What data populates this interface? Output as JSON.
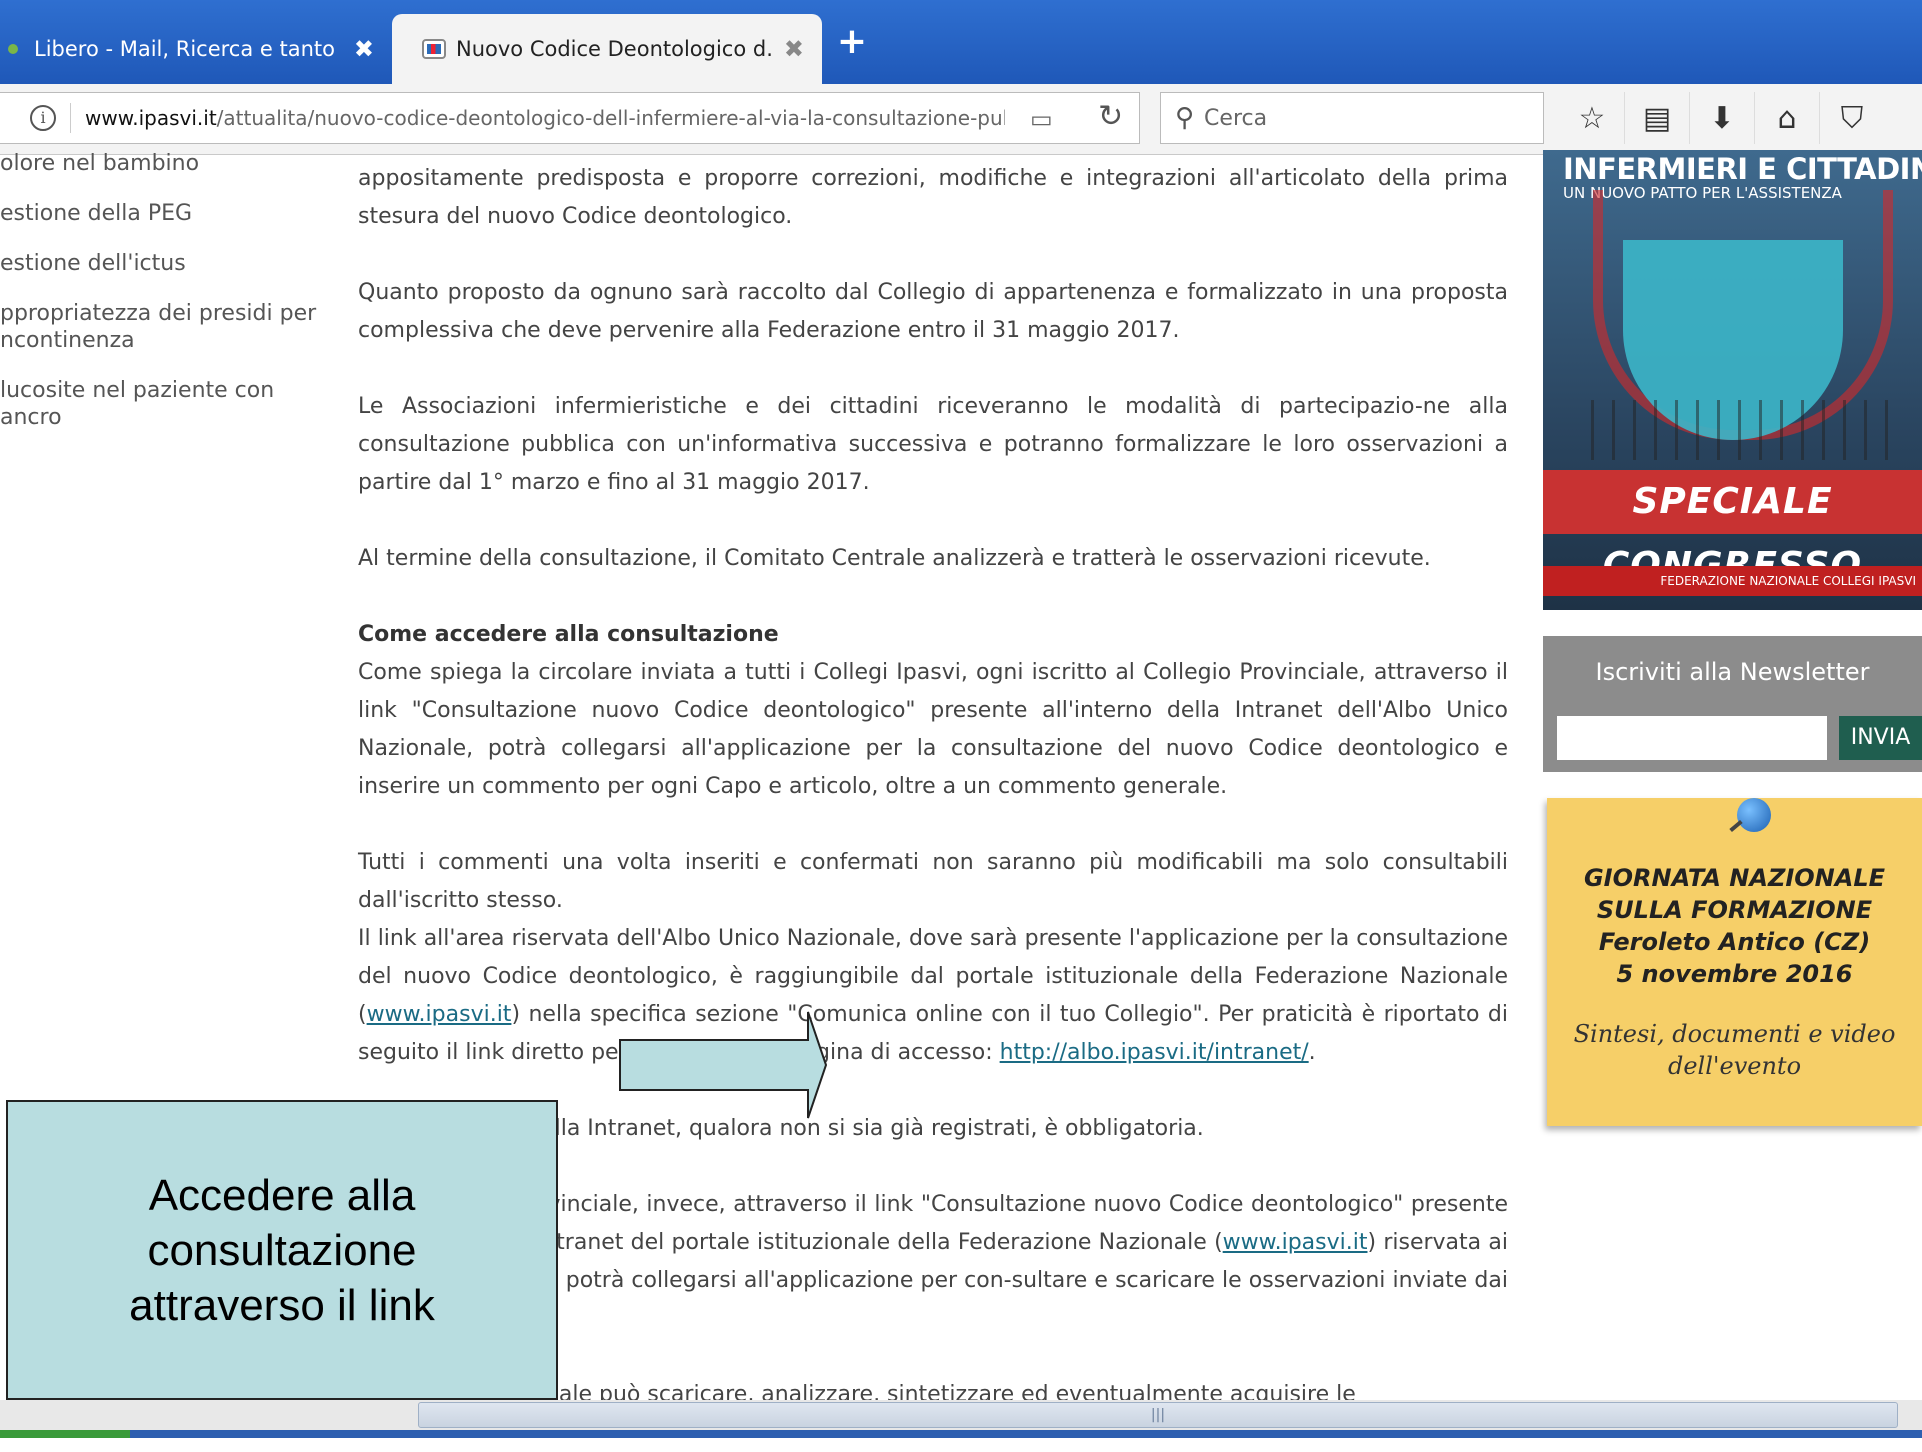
{
  "browser": {
    "tabs": [
      {
        "label": "Libero - Mail, Ricerca e tanto ...",
        "close": "✖"
      },
      {
        "label": "Nuovo Codice Deontologico d...",
        "close": "✖"
      }
    ],
    "new_tab": "+",
    "url_domain": "www.ipasvi.it",
    "url_path": "/attualita/nuovo-codice-deontologico-dell-infermiere-al-via-la-consultazione-pubb",
    "search_placeholder": "Cerca"
  },
  "left_menu": [
    "olore nel bambino",
    "estione della PEG",
    "estione dell'ictus",
    "ppropriatezza dei presidi per\nncontinenza",
    "lucosite nel paziente con\nancro"
  ],
  "article": {
    "p1": "appositamente predisposta e proporre correzioni, modifiche e integrazioni all'articolato della prima stesura del nuovo Codice deontologico.",
    "p2": "Quanto proposto da ognuno sarà raccolto dal Collegio di appartenenza e formalizzato in una proposta complessiva che deve pervenire alla Federazione entro il 31 maggio 2017.",
    "p3": "Le Associazioni infermieristiche e dei cittadini riceveranno le modalità di partecipazio-ne alla consultazione pubblica con un'informativa successiva e potranno formalizzare le loro osservazioni a partire dal 1° marzo e fino al 31 maggio 2017.",
    "p4": "Al termine della consultazione, il Comitato Centrale analizzerà e tratterà le osservazioni ricevute.",
    "heading": "Come accedere alla consultazione",
    "p5": "Come spiega la circolare inviata a tutti i Collegi Ipasvi, ogni iscritto al Collegio Provinciale, attraverso il link \"Consultazione nuovo Codice deontologico\" presente all'interno della Intranet dell'Albo Unico Nazionale, potrà collegarsi all'applicazione per la consultazione del nuovo Codice deontologico e inserire un commento per ogni Capo e articolo, oltre a un commento generale.",
    "p6": "Tutti i commenti una volta inseriti e confermati non saranno più modificabili ma solo consultabili dall'iscritto stesso.",
    "p7a": "Il link all'area riservata dell'Albo Unico Nazionale, dove sarà presente l'applicazione per la consultazione del nuovo Codice deontologico, è raggiungibile dal portale istituzionale della Federazione Nazionale (",
    "link_site": "www.ipasvi.it",
    "p7b": ") nella specifica sezione \"Comunica online con il tuo Collegio\". Per praticità è riportato di seguito il link diretto per accedere alla pagina di accesso: ",
    "link_intranet": "http://albo.ipasvi.it/intranet/",
    "p7c": ".",
    "p8": "La registrazione alla Intranet, qualora non si sia già registrati, è obbligatoria.",
    "p9a": "Ogni Collegio Provinciale, invece, attraverso il link \"Consultazione nuovo Codice deontologico\" presente all'interno della Intranet del portale istituzionale della Federazione Nazionale (",
    "p9b": ") riservata ai Collegi Provinciali, potrà collegarsi all'applicazione per con-sultare e scaricare le osservazioni inviate dai propri iscritti.",
    "p10": "Il Collegio Provinciale può scaricare, analizzare, sintetizzare ed eventualmente acquisire le"
  },
  "sidebar": {
    "banner_title": "INFERMIERI E CITTADINI:",
    "banner_subtitle": "UN NUOVO PATTO PER L'ASSISTENZA",
    "banner_speciale": "SPECIALE CONGRESSO",
    "banner_footer": "FEDERAZIONE NAZIONALE COLLEGI IPASVI",
    "newsletter_title": "Iscriviti alla Newsletter",
    "newsletter_button": "INVIA",
    "postit_title": "GIORNATA NAZIONALE\nSULLA FORMAZIONE\nFeroleto Antico (CZ)\n5 novembre 2016",
    "postit_subtitle": "Sintesi, documenti e video\ndell'evento"
  },
  "annotation": {
    "callout_text": "Accedere alla\nconsultazione\nattraverso il link"
  },
  "colors": {
    "tabstrip": "#2f6fd0",
    "callout": "#b8dde0",
    "link": "#1a6b84"
  }
}
